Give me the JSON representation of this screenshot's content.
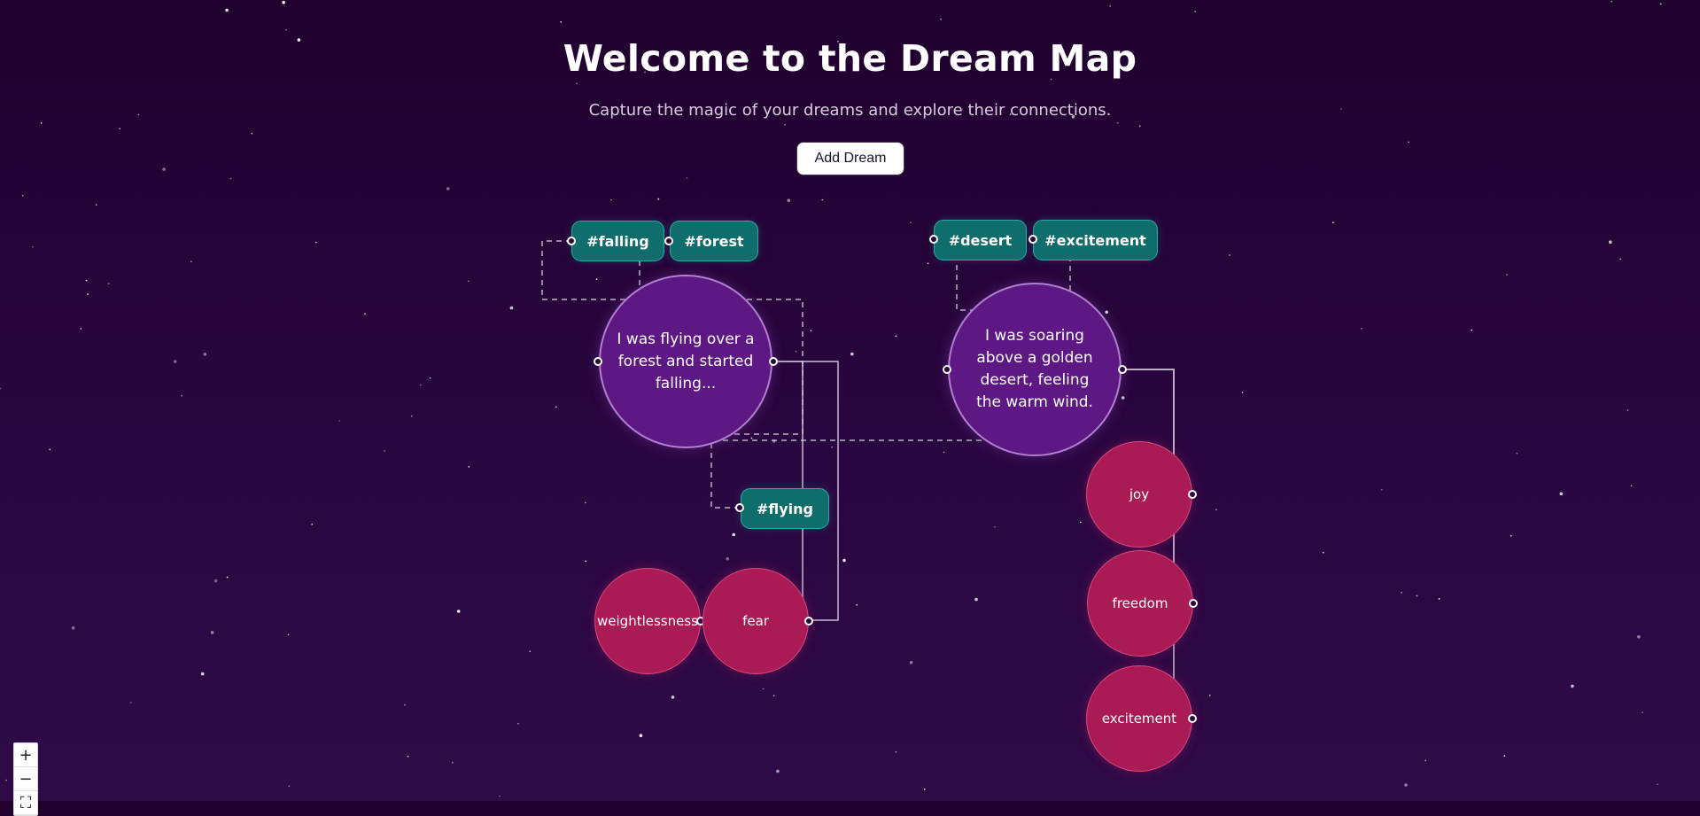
{
  "header": {
    "title": "Welcome to the Dream Map",
    "subtitle": "Capture the magic of your dreams and explore their connections.",
    "add_button_label": "Add Dream"
  },
  "tags": {
    "falling": "#falling",
    "forest": "#forest",
    "flying": "#flying",
    "desert": "#desert",
    "excitement": "#excitement"
  },
  "dreams": {
    "forest_dream": "I was flying over a forest and started falling...",
    "desert_dream": "I was soaring above a golden desert, feeling the warm wind."
  },
  "emotions": {
    "weightlessness": "weightlessness",
    "fear": "fear",
    "joy": "joy",
    "freedom": "freedom",
    "excitement": "excitement"
  },
  "controls": {
    "zoom_in": "+",
    "zoom_out": "−",
    "fit_view": "⛶"
  },
  "colors": {
    "background": "#24012f",
    "tag": "#0f6e6c",
    "dream": "#5e1884",
    "emotion": "#aa1a55"
  }
}
